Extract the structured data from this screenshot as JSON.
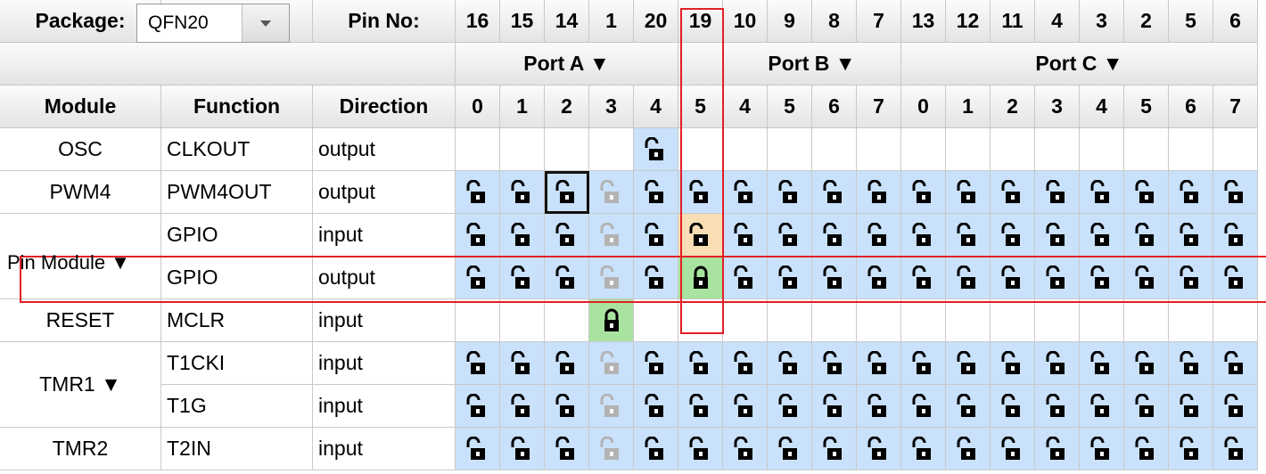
{
  "header": {
    "package_label": "Package:",
    "package_value": "QFN20",
    "pin_no_label": "Pin No:",
    "pins": [
      "16",
      "15",
      "14",
      "1",
      "20",
      "19",
      "10",
      "9",
      "8",
      "7",
      "13",
      "12",
      "11",
      "4",
      "3",
      "2",
      "5",
      "6"
    ]
  },
  "ports": {
    "a": "Port A ▼",
    "b": "Port B ▼",
    "c": "Port C ▼"
  },
  "columns": {
    "module": "Module",
    "function": "Function",
    "direction": "Direction",
    "bits": [
      "0",
      "1",
      "2",
      "3",
      "4",
      "5",
      "4",
      "5",
      "6",
      "7",
      "0",
      "1",
      "2",
      "3",
      "4",
      "5",
      "6",
      "7"
    ]
  },
  "rows": [
    {
      "module": "OSC",
      "function": "CLKOUT",
      "direction": "output"
    },
    {
      "module": "PWM4",
      "function": "PWM4OUT",
      "direction": "output"
    },
    {
      "module": "",
      "function": "GPIO",
      "direction": "input"
    },
    {
      "module": "",
      "function": "GPIO",
      "direction": "output"
    },
    {
      "module": "RESET",
      "function": "MCLR",
      "direction": "input"
    },
    {
      "module": "",
      "function": "T1CKI",
      "direction": "input"
    },
    {
      "module": "",
      "function": "T1G",
      "direction": "input"
    },
    {
      "module": "TMR2",
      "function": "T2IN",
      "direction": "input"
    }
  ],
  "groups": {
    "pin_module": "Pin Module ▼",
    "tmr1": "TMR1 ▼"
  },
  "colors": {
    "unlocked": "#c9e1fb",
    "orange": "#f8ddb5",
    "green": "#a9e3a0",
    "red": "#e21f26"
  }
}
